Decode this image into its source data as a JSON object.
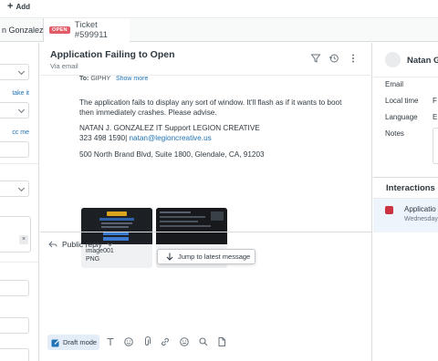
{
  "topbar": {
    "add_label": "Add"
  },
  "tabs": {
    "user_tab": "n Gonzalez",
    "ticket_badge": "OPEN",
    "ticket_label": "Ticket #599911"
  },
  "left_panel": {
    "link1": "take it",
    "link2": "cc me"
  },
  "ticket": {
    "title": "Application Failing to Open",
    "channel": "Via email"
  },
  "message": {
    "to_prefix": "To:",
    "to_value": "GIPHY",
    "show_more": "Show more",
    "body_line1": "The application fails to display any sort of window. It'll flash as if it wants to boot",
    "body_line2": "then immediately crashes. Please advise.",
    "sig_line1": "NATAN J. GONZALEZ IT Support LEGION CREATIVE",
    "sig_phone": "323 498 1590|",
    "sig_email": "natan@legioncreative.us",
    "address": "500 North Brand Blvd, Suite 1800, Glendale, CA, 91203"
  },
  "attachments": [
    {
      "name": "image001",
      "type": "PNG"
    }
  ],
  "jump_button": "Jump to latest message",
  "reply": {
    "mode_label": "Public reply"
  },
  "toolbar": {
    "draft_label": "Draft mode"
  },
  "requester": {
    "name": "Natan G",
    "fields": [
      {
        "label": "Email",
        "value": ""
      },
      {
        "label": "Local time",
        "value": "F"
      },
      {
        "label": "Language",
        "value": "E"
      },
      {
        "label": "Notes",
        "value": ""
      }
    ]
  },
  "interactions": {
    "heading": "Interactions",
    "items": [
      {
        "title": "Applicatio",
        "subtitle": "Wednesday"
      }
    ]
  },
  "colors": {
    "accent": "#1f73b7",
    "open_badge": "#e35b66",
    "draft_bg": "#e3ecf7",
    "interaction_highlight": "#edf4fb"
  }
}
